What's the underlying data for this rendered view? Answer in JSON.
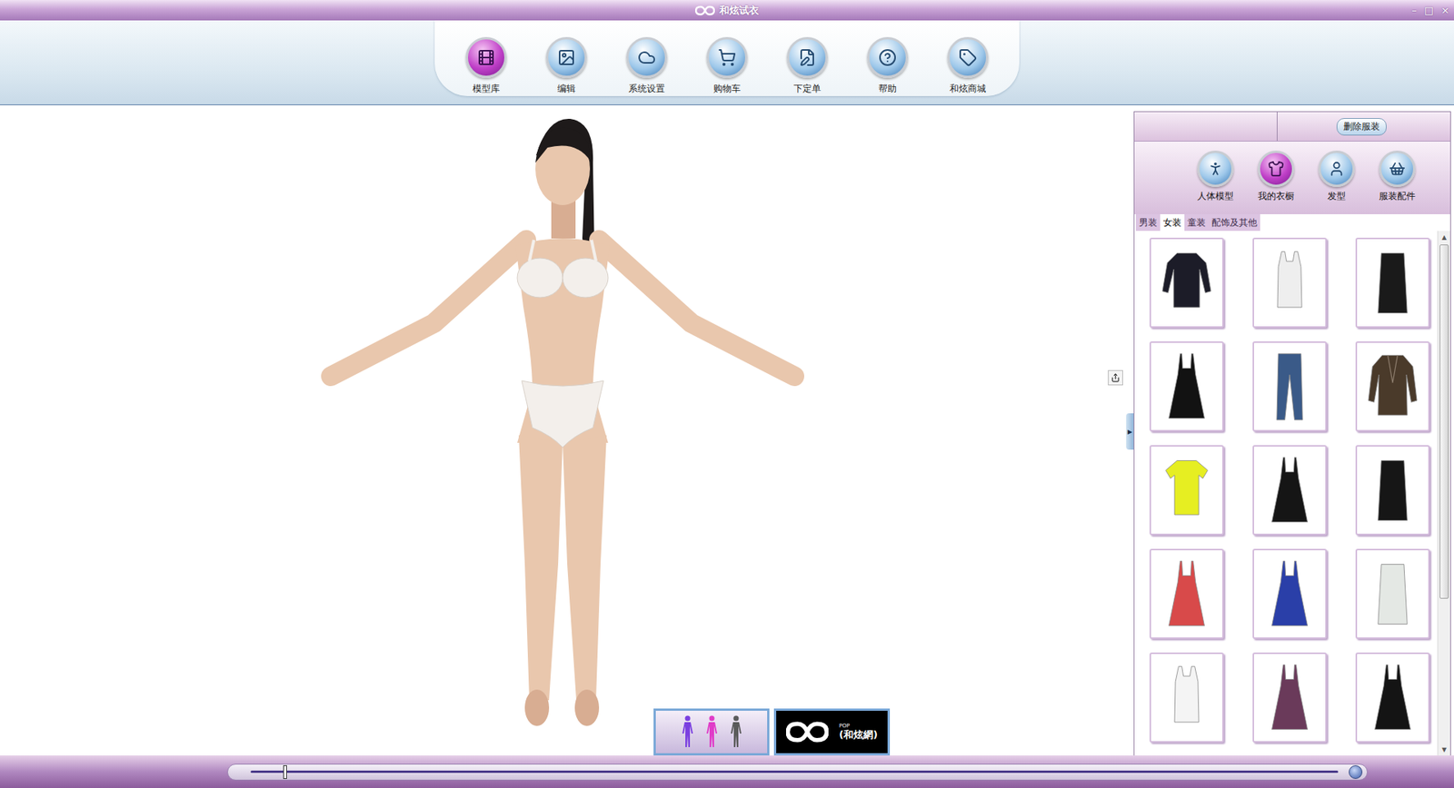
{
  "window": {
    "title": "和炫试衣",
    "controls": [
      "–",
      "□",
      "×"
    ]
  },
  "toolbar": [
    {
      "label": "模型库",
      "selected": true
    },
    {
      "label": "编辑",
      "selected": false
    },
    {
      "label": "系统设置",
      "selected": false
    },
    {
      "label": "购物车",
      "selected": false
    },
    {
      "label": "下定单",
      "selected": false
    },
    {
      "label": "帮助",
      "selected": false
    },
    {
      "label": "和炫商城",
      "selected": false
    }
  ],
  "viewer": {
    "view_modes": [
      {
        "color": "#7a3fe0"
      },
      {
        "color": "#e03cc8"
      },
      {
        "color": "#5a5a5a"
      }
    ],
    "logo": {
      "mark": "POP",
      "name": "(和炫網)"
    }
  },
  "right_panel": {
    "toggle": "▶",
    "delete_button": "删除服装",
    "categories": [
      {
        "label": "人体模型",
        "selected": false
      },
      {
        "label": "我的衣橱",
        "selected": true
      },
      {
        "label": "发型",
        "selected": false
      },
      {
        "label": "服装配件",
        "selected": false
      }
    ],
    "tabs": [
      {
        "label": "男装",
        "selected": false
      },
      {
        "label": "女装",
        "selected": true
      },
      {
        "label": "童装",
        "selected": false
      },
      {
        "label": "配饰及其他",
        "selected": false
      }
    ],
    "garments": [
      {
        "kind": "top",
        "color": "#1c1c28"
      },
      {
        "kind": "tank",
        "color": "#eeeeee"
      },
      {
        "kind": "skirt",
        "color": "#1a1a1a"
      },
      {
        "kind": "dress",
        "color": "#121212"
      },
      {
        "kind": "pants",
        "color": "#3a5a88"
      },
      {
        "kind": "jacket",
        "color": "#4a3a2a"
      },
      {
        "kind": "tee",
        "color": "#e6ee22"
      },
      {
        "kind": "dress",
        "color": "#151515"
      },
      {
        "kind": "skirt",
        "color": "#161616"
      },
      {
        "kind": "dress",
        "color": "#d84a4a"
      },
      {
        "kind": "dress",
        "color": "#2a3fa8"
      },
      {
        "kind": "skirt",
        "color": "#e4e8e4"
      },
      {
        "kind": "tank",
        "color": "#f4f4f4"
      },
      {
        "kind": "dress",
        "color": "#6a3a5a"
      },
      {
        "kind": "dress",
        "color": "#141414"
      }
    ],
    "scrollbar": {
      "up": "▲",
      "down": "▼",
      "level": 0.71
    }
  },
  "timeline": {
    "level": 0.03
  }
}
